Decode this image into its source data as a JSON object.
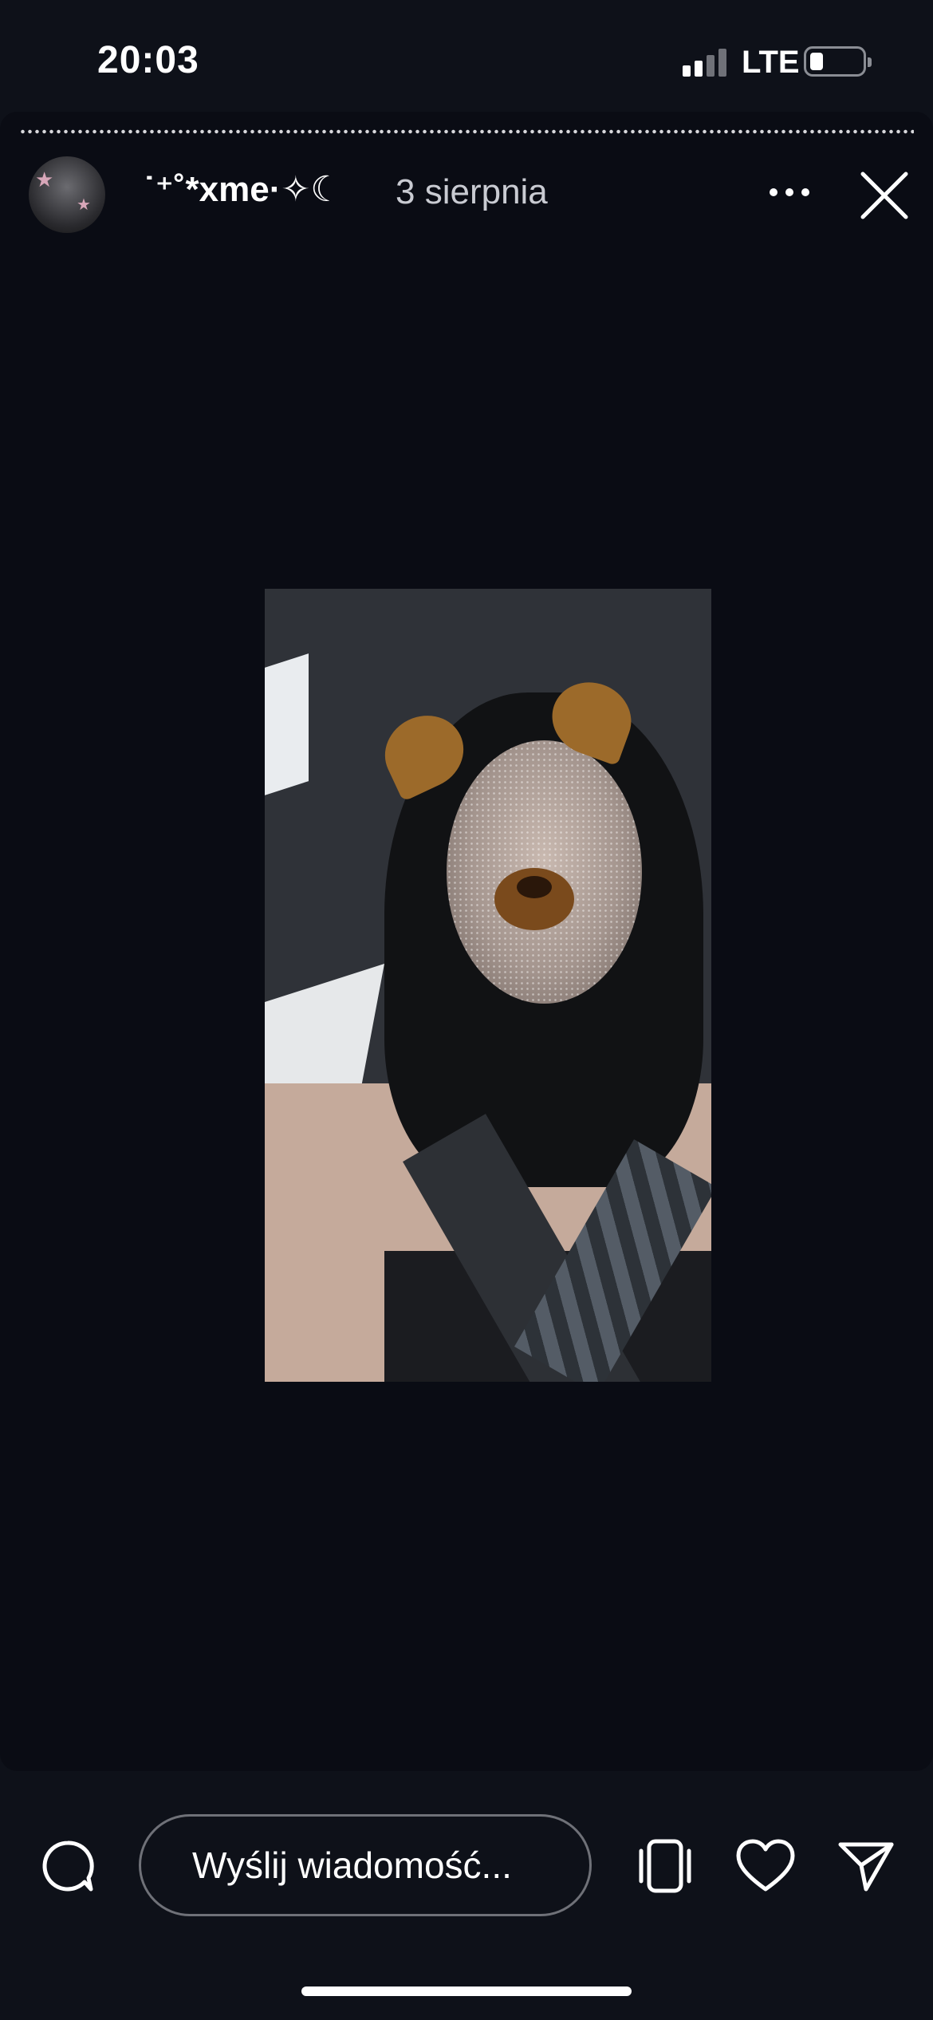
{
  "status_bar": {
    "time": "20:03",
    "network": "LTE",
    "signal_bars_filled": 2,
    "signal_bars_total": 4,
    "battery_level": 0.2
  },
  "story": {
    "progress_segments": 1,
    "username": "˙⁺˚*xme·✧☾",
    "date": "3 sierpnia",
    "photo_description_icon": "story-photo"
  },
  "bottom_bar": {
    "message_placeholder": "Wyślij wiadomość..."
  },
  "icons": {
    "comment": "comment-icon",
    "remix": "remix-icon",
    "like": "heart-icon",
    "share": "send-icon",
    "more": "more-icon",
    "close": "close-icon"
  },
  "colors": {
    "background": "#0e1119",
    "panel": "#0a0c14",
    "text": "#ffffff",
    "secondary_text": "#c9cbd2"
  }
}
